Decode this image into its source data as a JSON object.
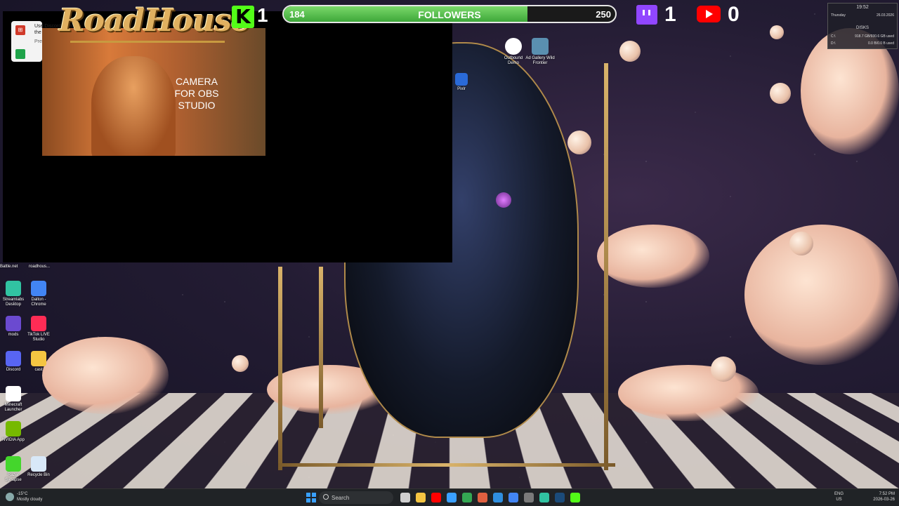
{
  "overlay": {
    "logo": "RoadHouse",
    "camera_label": "CAMERA FOR OBS STUDIO",
    "kick": {
      "icon": "kick-icon",
      "count": "1",
      "color": "#53fc18"
    },
    "followers": {
      "current": "184",
      "label": "FOLLOWERS",
      "goal": "250",
      "progress": 0.736
    },
    "twitch": {
      "icon": "twitch-icon",
      "count": "1",
      "color": "#9146ff"
    },
    "youtube": {
      "icon": "youtube-icon",
      "count": "0",
      "color": "#ff0000"
    }
  },
  "discord_toast": {
    "text": "Use Discord from the pla...",
    "pre": "Pres"
  },
  "system_widget": {
    "time": "19:52",
    "day": "Thursday",
    "date": "26.03.2026",
    "disks_title": "DISKS",
    "c_label": "C:\\",
    "c_value": "918.7 GB/930.6 GB used",
    "d_label": "D:\\",
    "d_value": "0.0 B/0.0 B used"
  },
  "desktop": {
    "top_icons": [
      {
        "label": "Outbound Demo",
        "icon": "outbound-demo-icon"
      },
      {
        "label": "Ad Gallery Wild Frontier",
        "icon": "ad-gallery-icon"
      },
      {
        "label": "Pixlr",
        "icon": "pixlr-icon"
      }
    ],
    "left_top_labels": [
      "Battle.net",
      "roadhous..."
    ],
    "left_icons": [
      {
        "label": "Streamlabs Desktop",
        "icon": "streamlabs-icon",
        "color": "#31c3a2"
      },
      {
        "label": "Dalton - Chrome",
        "icon": "chrome-icon",
        "color": "#4285f4"
      },
      {
        "label": "mods",
        "icon": "mods-icon",
        "color": "#6b4ad0"
      },
      {
        "label": "TikTok LIVE Studio",
        "icon": "tiktok-icon",
        "color": "#fe2c55"
      },
      {
        "label": "Discord",
        "icon": "discord-icon",
        "color": "#5865f2"
      },
      {
        "label": "cast",
        "icon": "folder-icon",
        "color": "#f4c542"
      },
      {
        "label": "Minecraft Launcher",
        "icon": "minecraft-icon",
        "color": "#ffffff"
      },
      {
        "label": "NVIDIA App",
        "icon": "nvidia-icon",
        "color": "#76b900"
      },
      {
        "label": "Razer Synapse",
        "icon": "razer-icon",
        "color": "#44d62c"
      },
      {
        "label": "Recycle Bin",
        "icon": "recycle-bin-icon",
        "color": "#d8e8f8"
      }
    ]
  },
  "taskbar": {
    "weather_temp": "-15°C",
    "weather_desc": "Mostly cloudy",
    "search_placeholder": "Search",
    "lang_top": "ENG",
    "lang_bottom": "US",
    "clock_time": "7:52 PM",
    "clock_date": "2026-03-26",
    "apps": [
      {
        "name": "task-view-icon",
        "color": "#cfcfcf"
      },
      {
        "name": "file-explorer-icon",
        "color": "#f4c542"
      },
      {
        "name": "youtube-taskbar-icon",
        "color": "#ff0000"
      },
      {
        "name": "edge-icon",
        "color": "#3aa0ff"
      },
      {
        "name": "google-drive-icon",
        "color": "#34a853"
      },
      {
        "name": "app-icon",
        "color": "#e06040"
      },
      {
        "name": "vscode-icon",
        "color": "#2f8fe0"
      },
      {
        "name": "chrome-taskbar-icon",
        "color": "#4285f4"
      },
      {
        "name": "obs-icon",
        "color": "#7a7a7a"
      },
      {
        "name": "streamlabs-taskbar-icon",
        "color": "#31c3a2"
      },
      {
        "name": "steam-icon",
        "color": "#1b4b7a"
      },
      {
        "name": "green-app-icon",
        "color": "#53fc18"
      }
    ]
  }
}
